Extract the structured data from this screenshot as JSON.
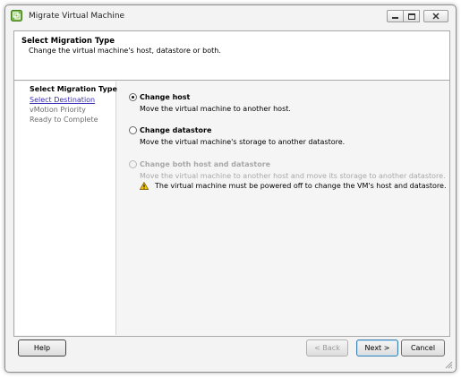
{
  "window": {
    "title": "Migrate Virtual Machine"
  },
  "header": {
    "title": "Select Migration Type",
    "subtitle": "Change the virtual machine's host, datastore or both."
  },
  "steps": [
    {
      "label": "Select Migration Type",
      "state": "current"
    },
    {
      "label": "Select Destination",
      "state": "link"
    },
    {
      "label": "vMotion Priority",
      "state": "inactive"
    },
    {
      "label": "Ready to Complete",
      "state": "inactive"
    }
  ],
  "options": [
    {
      "label": "Change host",
      "description": "Move the virtual machine to another host.",
      "selected": true,
      "enabled": true
    },
    {
      "label": "Change datastore",
      "description": "Move the virtual machine's storage to another datastore.",
      "selected": false,
      "enabled": true
    },
    {
      "label": "Change both host and datastore",
      "description": "Move the virtual machine to another host and move its storage to another datastore.",
      "selected": false,
      "enabled": false
    }
  ],
  "warning": {
    "icon": "warning-icon",
    "text": "The virtual machine must be powered off to change the VM's host and datastore."
  },
  "buttons": {
    "help": "Help",
    "back": "< Back",
    "next": "Next >",
    "cancel": "Cancel"
  },
  "colors": {
    "link": "#3a2fb7",
    "disabled_text": "#a8a8a8",
    "warning_fill": "#f4c400"
  }
}
